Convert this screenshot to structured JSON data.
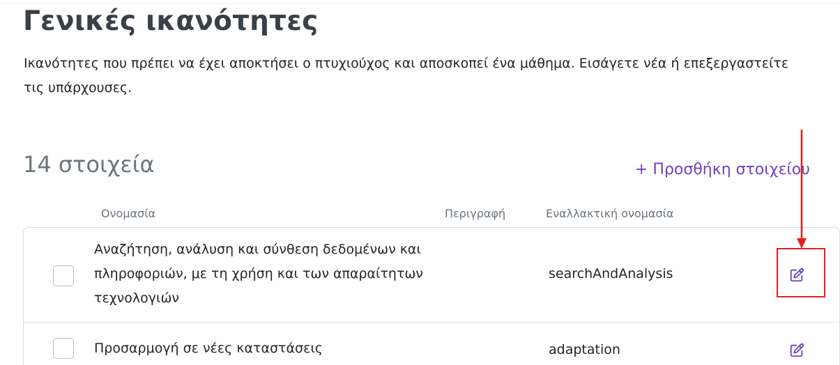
{
  "page": {
    "title": "Γενικές ικανότητες",
    "description": "Ικανότητες που πρέπει να έχει αποκτήσει ο πτυχιούχος και αποσκοπεί ένα μάθημα. Εισάγετε νέα ή επεξεργαστείτε τις υπάρχουσες."
  },
  "list": {
    "count_label": "14 στοιχεία",
    "add_label": "+ Προσθήκη στοιχείου",
    "columns": {
      "name": "Ονομασία",
      "description": "Περιγραφή",
      "alt_name": "Εναλλακτική ονομασία"
    },
    "rows": [
      {
        "name": "Αναζήτηση, ανάλυση και σύνθεση δεδομένων και πληροφοριών, με τη χρήση και των απαραίτητων τεχνολογιών",
        "description": "",
        "alt_name": "searchAndAnalysis"
      },
      {
        "name": "Προσαρμογή σε νέες καταστάσεις",
        "description": "",
        "alt_name": "adaptation"
      }
    ]
  },
  "icons": {
    "edit": "edit-icon"
  },
  "colors": {
    "accent": "#6f42c1",
    "annotation": "#e02020",
    "muted_text": "#6c757d",
    "border": "#d9dde2"
  }
}
